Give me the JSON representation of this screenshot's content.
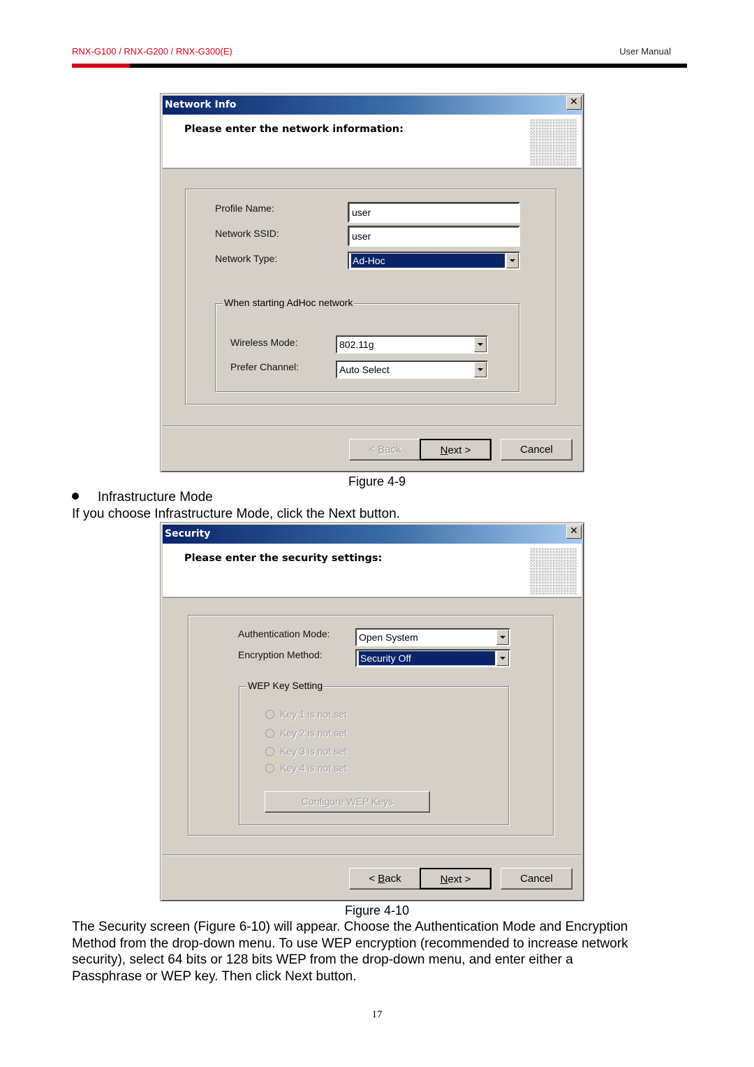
{
  "header": {
    "models": "RNX-G100 / RNX-G200 / RNX-G300(E)",
    "doc_type": "User Manual",
    "colors": {
      "accent": "#d0021b",
      "bar": "#000000"
    }
  },
  "dialog1": {
    "title": "Network Info",
    "heading": "Please enter the network information:",
    "profile_name_label": "Profile Name:",
    "profile_name_value": "user",
    "ssid_label": "Network SSID:",
    "ssid_value": "user",
    "network_type_label": "Network Type:",
    "network_type_value": "Ad-Hoc",
    "adhoc_group_label": "When starting AdHoc network",
    "wireless_mode_label": "Wireless Mode:",
    "wireless_mode_value": "802.11g",
    "prefer_channel_label": "Prefer Channel:",
    "prefer_channel_value": "Auto Select",
    "back_prefix": "< ",
    "back_key": "B",
    "back_rest": "ack",
    "next_key": "N",
    "next_rest": "ext >",
    "cancel": "Cancel"
  },
  "caption1": "Figure 4-9",
  "bullet_item": "Infrastructure Mode",
  "intro_text": "If you choose Infrastructure Mode, click the Next button.",
  "dialog2": {
    "title": "Security",
    "heading": "Please enter the security settings:",
    "auth_label": "Authentication Mode:",
    "auth_value": "Open System",
    "enc_label": "Encryption Method:",
    "enc_value": "Security Off",
    "wep_group_label": "WEP Key Setting",
    "keys": [
      "Key 1 is not set",
      "Key 2 is not set",
      "Key 3 is not set",
      "Key 4 is not set"
    ],
    "configure_button": "Configure WEP Keys",
    "back_prefix": "< ",
    "back_key": "B",
    "back_rest": "ack",
    "next_key": "N",
    "next_rest": "ext >",
    "cancel": "Cancel"
  },
  "caption2": "Figure 4-10",
  "description": [
    "The Security screen (Figure 6-10) will appear. Choose the Authentication Mode and Encryption",
    "Method from the drop-down menu. To use WEP encryption (recommended to increase network",
    "security), select 64 bits or 128 bits WEP from the drop-down menu, and enter either a",
    "Passphrase or WEP key. Then click Next button."
  ],
  "page_number": "17"
}
